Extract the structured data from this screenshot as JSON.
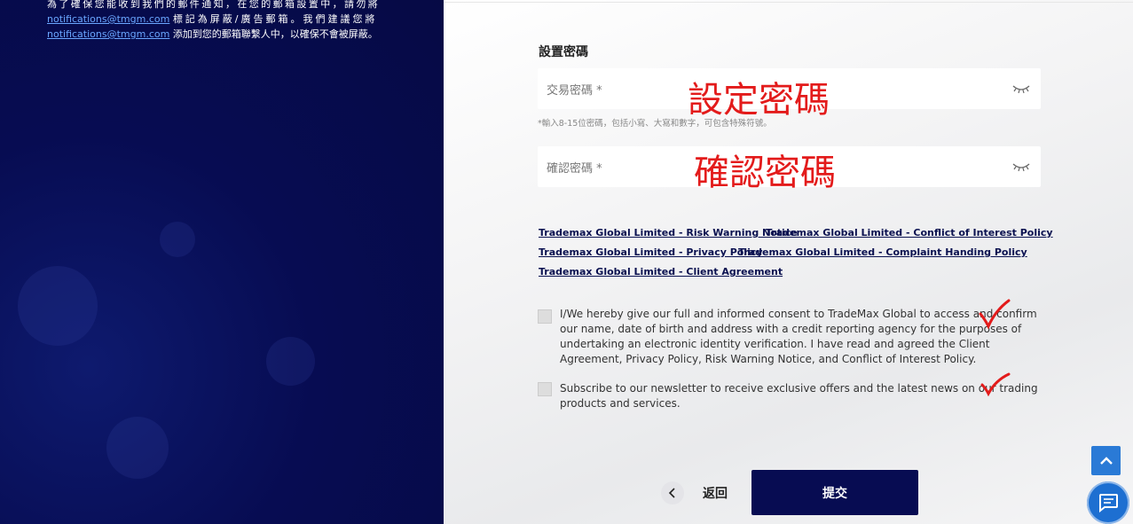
{
  "notice": {
    "line1": "為了確保您能收到我們的郵件通知，在您的郵箱設置中，請勿將",
    "email1": "notifications@tmgm.com",
    "line2": "標記為屏蔽/廣告郵箱。我們建議您將",
    "email2": "notifications@tmgm.com",
    "line3": "添加到您的郵箱聯繫人中，以確保不會被屏蔽。"
  },
  "form": {
    "section_title": "設置密碼",
    "password_placeholder": "交易密碼 *",
    "password_hint": "*輸入8-15位密碼，包括小寫、大寫和數字，可包含特殊符號。",
    "confirm_placeholder": "確認密碼 *",
    "eye_icon": "eye-closed-icon"
  },
  "annotations": {
    "set_password": "設定密碼",
    "confirm_password": "確認密碼",
    "color": "#e31b1b"
  },
  "links": [
    "Trademax Global Limited - Risk Warning Notice",
    "Trademax Global Limited - Conflict of Interest Policy",
    "Trademax Global Limited - Privacy Policy",
    "Trademax Global Limited - Complaint Handing Policy",
    "Trademax Global Limited - Client Agreement"
  ],
  "consents": {
    "consent_text": "I/We hereby give our full and informed consent to TradeMax Global to access and confirm our name, date of birth and address with a credit reporting agency for the purposes of undertaking an electronic identity verification. I have read and agreed the Client Agreement, Privacy Policy, Risk Warning Notice, and Conflict of Interest Policy.",
    "newsletter_text": "Subscribe to our newsletter to receive exclusive offers and the latest news on our trading products and services."
  },
  "actions": {
    "back_label": "返回",
    "back_icon": "chevron-left-icon",
    "submit_label": "提交"
  },
  "floating": {
    "scroll_top_icon": "chevron-up-icon",
    "chat_icon": "chat-bubble-icon"
  },
  "colors": {
    "brand_dark": "#070c52",
    "link": "#0a1150",
    "accent_blue": "#2a7ad6"
  }
}
